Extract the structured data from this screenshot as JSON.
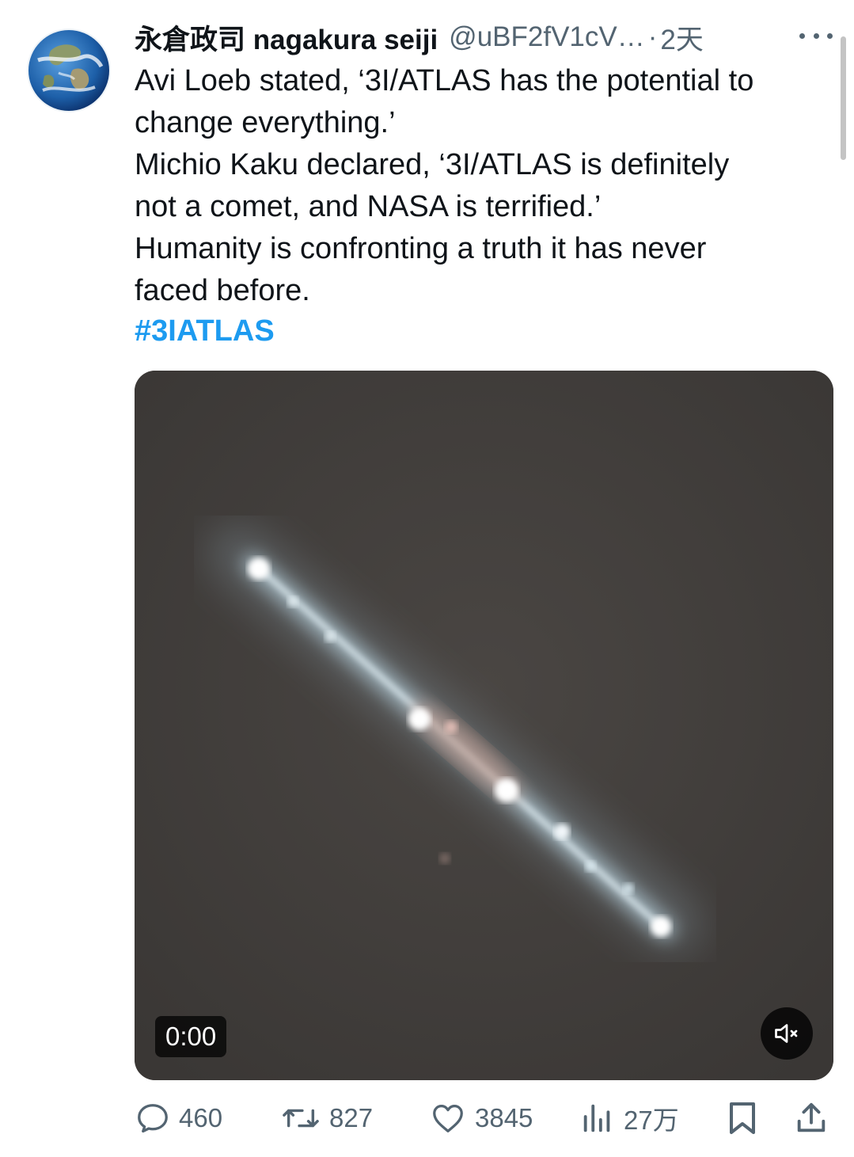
{
  "tweet": {
    "display_name": "永倉政司 nagakura seiji",
    "handle": "@uBF2fV1cV…",
    "separator": "·",
    "time": "2天",
    "text_lines": [
      "Avi Loeb stated, ‘3I/ATLAS has the potential to",
      "change everything.’",
      "Michio Kaku declared, ‘3I/ATLAS is definitely",
      "not a comet, and NASA is terrified.’",
      "Humanity is confronting a truth it has never",
      "faced before."
    ],
    "hashtag": "#3IATLAS",
    "avatar_icon": "earth-globe-avatar"
  },
  "video": {
    "timer": "0:00",
    "mute_icon": "speaker-muted-icon"
  },
  "actions": {
    "replies": "460",
    "retweets": "827",
    "likes": "3845",
    "views": "27万"
  },
  "colors": {
    "link": "#1d9bf0",
    "secondary_text": "#536471",
    "primary_text": "#0f1419",
    "media_background": "#423f3d"
  }
}
